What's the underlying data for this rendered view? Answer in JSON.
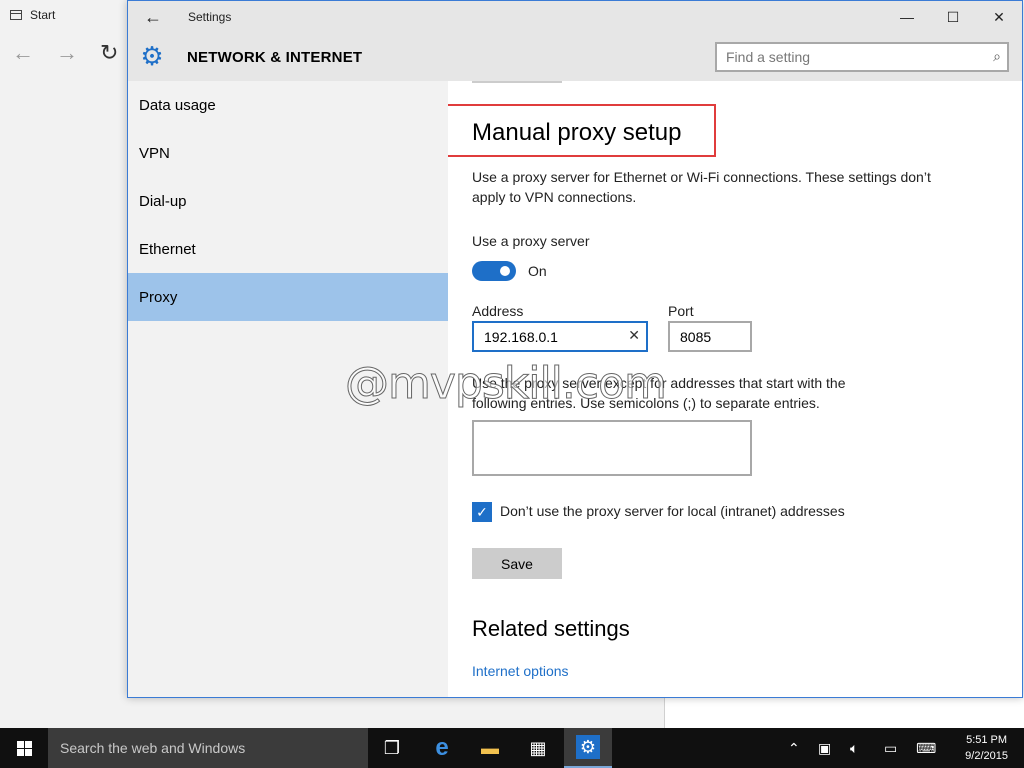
{
  "background_window": {
    "tab_title": "Start",
    "nav_back": "←",
    "nav_forward": "→",
    "nav_refresh": "↻"
  },
  "settings": {
    "window_title": "Settings",
    "back_glyph": "←",
    "minimize_glyph": "—",
    "maximize_glyph": "☐",
    "close_glyph": "✕",
    "header_title": "NETWORK & INTERNET",
    "search_placeholder": "Find a setting",
    "sidebar": {
      "items": [
        {
          "label": "Data usage",
          "active": false
        },
        {
          "label": "VPN",
          "active": false
        },
        {
          "label": "Dial-up",
          "active": false
        },
        {
          "label": "Ethernet",
          "active": false
        },
        {
          "label": "Proxy",
          "active": true
        }
      ]
    },
    "content": {
      "section_title": "Manual proxy setup",
      "description": "Use a proxy server for Ethernet or Wi-Fi connections. These settings don’t apply to VPN connections.",
      "use_proxy_label": "Use a proxy server",
      "toggle_state": "On",
      "address_label": "Address",
      "address_value": "192.168.0.1",
      "clear_glyph": "✕",
      "port_label": "Port",
      "port_value": "8085",
      "exceptions_text": "Use the proxy server except for addresses that start with the following entries. Use semicolons (;) to separate entries.",
      "exceptions_value": "",
      "bypass_local_label": "Don’t use the proxy server for local (intranet) addresses",
      "bypass_local_checked": true,
      "save_label": "Save",
      "related_title": "Related settings",
      "internet_options_link": "Internet options"
    }
  },
  "watermark": "@mvpskill.com",
  "taskbar": {
    "search_placeholder": "Search the web and Windows",
    "clock_time": "5:51 PM",
    "clock_date": "9/2/2015"
  },
  "colors": {
    "accent": "#1e6fc8",
    "sidebar_active": "#9dc3ea",
    "highlight_box": "#e03c3c",
    "taskbar": "#101010"
  }
}
